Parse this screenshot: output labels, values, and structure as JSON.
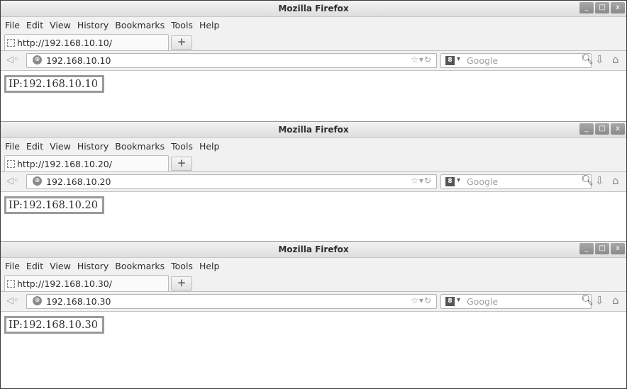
{
  "windows": [
    {
      "title": "Mozilla Firefox",
      "menu": [
        "File",
        "Edit",
        "View",
        "History",
        "Bookmarks",
        "Tools",
        "Help"
      ],
      "tab_label": "http://192.168.10.10/",
      "url": "192.168.10.10",
      "search_placeholder": "Google",
      "page_text": "IP:192.168.10.10"
    },
    {
      "title": "Mozilla Firefox",
      "menu": [
        "File",
        "Edit",
        "View",
        "History",
        "Bookmarks",
        "Tools",
        "Help"
      ],
      "tab_label": "http://192.168.10.20/",
      "url": "192.168.10.20",
      "search_placeholder": "Google",
      "page_text": "IP:192.168.10.20"
    },
    {
      "title": "Mozilla Firefox",
      "menu": [
        "File",
        "Edit",
        "View",
        "History",
        "Bookmarks",
        "Tools",
        "Help"
      ],
      "tab_label": "http://192.168.10.30/",
      "url": "192.168.10.30",
      "search_placeholder": "Google",
      "page_text": "IP:192.168.10.30"
    }
  ],
  "icons": {
    "window_controls": [
      "minimize-icon",
      "maximize-icon",
      "close-icon"
    ],
    "nav": [
      "back-icon",
      "globe-icon",
      "star-icon",
      "dropmarker-icon",
      "reload-icon",
      "search-engine-icon",
      "search-icon",
      "download-icon",
      "home-icon"
    ]
  }
}
